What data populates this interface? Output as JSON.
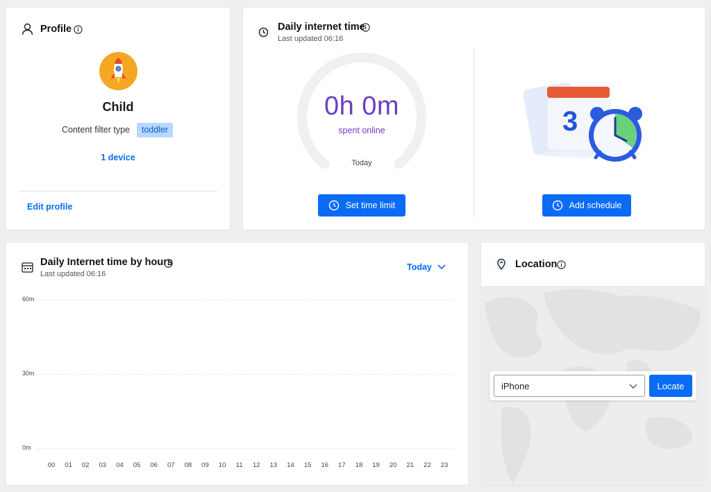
{
  "profile": {
    "title": "Profile",
    "name": "Child",
    "filter_label": "Content filter type",
    "filter_value": "toddler",
    "devices": "1 device",
    "edit": "Edit profile"
  },
  "daily": {
    "title": "Daily internet time",
    "updated": "Last updated 06:16",
    "time": "0h 0m",
    "spent": "spent online",
    "period": "Today",
    "set_limit": "Set time limit",
    "add_schedule": "Add schedule",
    "calendar_day": "3"
  },
  "hours": {
    "title": "Daily Internet time by hours",
    "updated": "Last updated 06:16",
    "dropdown": "Today",
    "y_ticks": [
      "60m",
      "30m",
      "0m"
    ],
    "x_ticks": [
      "00",
      "01",
      "02",
      "03",
      "04",
      "05",
      "06",
      "07",
      "08",
      "09",
      "10",
      "11",
      "12",
      "13",
      "14",
      "15",
      "16",
      "17",
      "18",
      "19",
      "20",
      "21",
      "22",
      "23"
    ]
  },
  "location": {
    "title": "Location",
    "device": "iPhone",
    "locate": "Locate"
  },
  "colors": {
    "accent": "#0a6cf5",
    "purple": "#6a3fc0",
    "tag_bg": "#b7d7ff"
  }
}
